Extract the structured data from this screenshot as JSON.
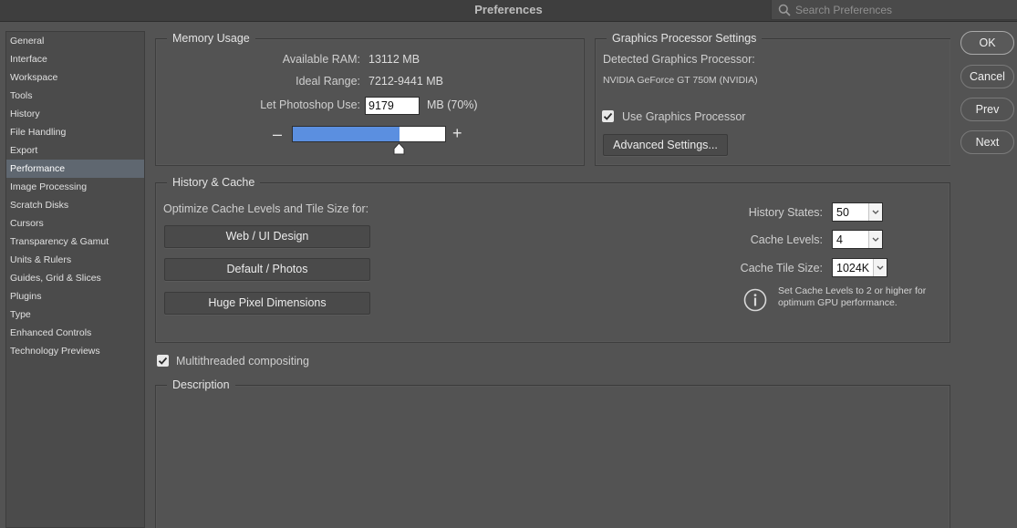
{
  "window": {
    "title": "Preferences",
    "search_placeholder": "Search Preferences"
  },
  "sidebar": {
    "selected": "Performance",
    "items": [
      {
        "label": "General"
      },
      {
        "label": "Interface"
      },
      {
        "label": "Workspace"
      },
      {
        "label": "Tools"
      },
      {
        "label": "History"
      },
      {
        "label": "File Handling"
      },
      {
        "label": "Export"
      },
      {
        "label": "Performance"
      },
      {
        "label": "Image Processing"
      },
      {
        "label": "Scratch Disks"
      },
      {
        "label": "Cursors"
      },
      {
        "label": "Transparency & Gamut"
      },
      {
        "label": "Units & Rulers"
      },
      {
        "label": "Guides, Grid & Slices"
      },
      {
        "label": "Plugins"
      },
      {
        "label": "Type"
      },
      {
        "label": "Enhanced Controls"
      },
      {
        "label": "Technology Previews"
      }
    ]
  },
  "memory": {
    "legend": "Memory Usage",
    "available_label": "Available RAM:",
    "available_value": "13112 MB",
    "range_label": "Ideal Range:",
    "range_value": "7212-9441 MB",
    "use_label": "Let Photoshop Use:",
    "use_value": "9179",
    "use_suffix": "MB (70%)",
    "minus": "–",
    "plus": "+",
    "slider_fraction": 0.7
  },
  "gpu": {
    "legend": "Graphics Processor Settings",
    "detected_label": "Detected Graphics Processor:",
    "detected_value": "NVIDIA GeForce GT 750M (NVIDIA)",
    "use_gpu_label": "Use Graphics Processor",
    "use_gpu_checked": true,
    "advanced_button": "Advanced Settings..."
  },
  "history_cache": {
    "legend": "History & Cache",
    "optimize_label": "Optimize Cache Levels and Tile Size for:",
    "buttons": [
      "Web / UI Design",
      "Default / Photos",
      "Huge Pixel Dimensions"
    ],
    "history_states_label": "History States:",
    "history_states_value": "50",
    "cache_levels_label": "Cache Levels:",
    "cache_levels_value": "4",
    "tile_size_label": "Cache Tile Size:",
    "tile_size_value": "1024K",
    "info_text": "Set Cache Levels to 2 or higher for optimum GPU performance."
  },
  "multithreaded": {
    "label": "Multithreaded compositing",
    "checked": true
  },
  "description": {
    "legend": "Description"
  },
  "actions": {
    "ok": "OK",
    "cancel": "Cancel",
    "prev": "Prev",
    "next": "Next"
  },
  "colors": {
    "bar_fill": "#5b8fe0",
    "selected_item": "#5f6770",
    "background": "#535353"
  }
}
